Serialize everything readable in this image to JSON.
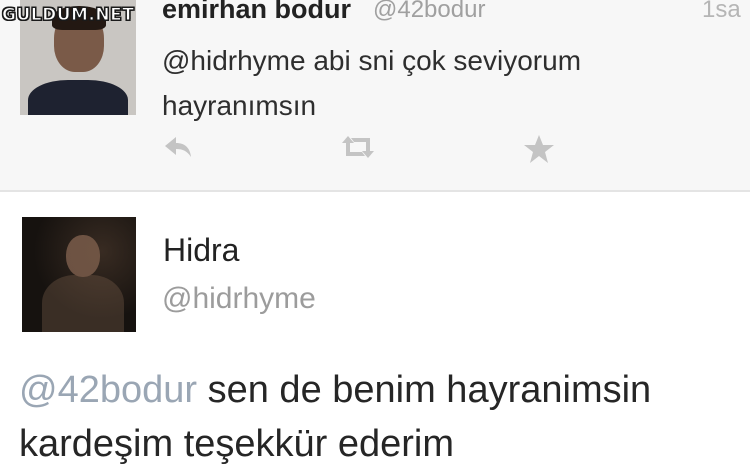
{
  "watermark": "GULDUM.NET",
  "tweet_top": {
    "display_name": "emirhan bodur",
    "handle": "@42bodur",
    "time": "1sa",
    "text_line1": "@hidrhyme  abi sni çok seviyorum",
    "text_line2": "hayranımsın",
    "actions": {
      "reply_icon": "reply-icon",
      "retweet_icon": "retweet-icon",
      "favorite_icon": "star-icon"
    }
  },
  "tweet_bottom": {
    "display_name": "Hidra",
    "handle": "@hidrhyme",
    "mention": "@42bodur",
    "text_rest": " sen de benim hayranimsin",
    "text_line2": "kardeşim teşekkür ederim"
  },
  "colors": {
    "handle_gray": "#a0a0a0",
    "mention_blue_gray": "#9aa6b4",
    "action_icon_gray": "#c4c4c4"
  }
}
